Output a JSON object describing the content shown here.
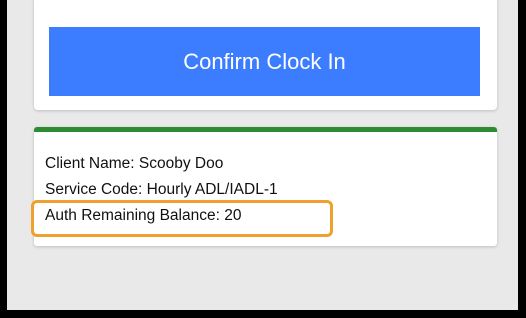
{
  "actions": {
    "confirm_clock_in_label": "Confirm Clock In"
  },
  "client_info": {
    "client_name": "Client Name: Scooby Doo",
    "service_code": "Service Code: Hourly ADL/IADL-1",
    "auth_remaining_balance": "Auth Remaining Balance: 20"
  },
  "colors": {
    "primary_button": "#3c7dff",
    "card_accent": "#2e8b32",
    "highlight": "#f0a02c"
  }
}
